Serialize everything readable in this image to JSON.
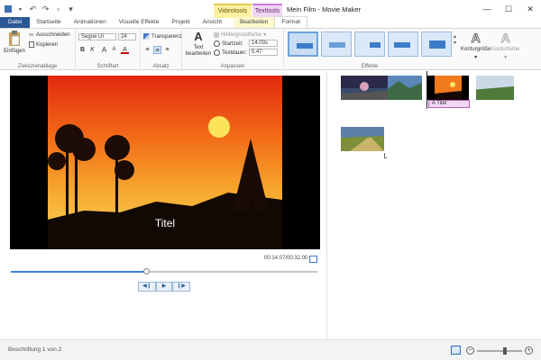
{
  "window": {
    "title": "Mein Film - Movie Maker",
    "context_video": "Videotools",
    "context_text": "Texttools",
    "minimize": "—",
    "maximize": "☐",
    "close": "✕"
  },
  "qat": {
    "save": "▪",
    "undo": "↶",
    "redo": "↷",
    "new": "▫",
    "more": "▾"
  },
  "tabs": [
    {
      "label": "Datei"
    },
    {
      "label": "Startseite"
    },
    {
      "label": "Animationen"
    },
    {
      "label": "Visuelle Effekte"
    },
    {
      "label": "Projekt"
    },
    {
      "label": "Ansicht"
    },
    {
      "label": "Bearbeiten"
    },
    {
      "label": "Format"
    }
  ],
  "ribbon": {
    "clipboard": {
      "label": "Zwischenablage",
      "paste": "Einfügen",
      "cut": "Ausschneiden",
      "copy": "Kopieren"
    },
    "font": {
      "label": "Schriftart",
      "family": "Segoe UI",
      "size": "24",
      "bold": "B",
      "italic": "K",
      "grow": "A",
      "shrink": "A",
      "color": "A"
    },
    "paragraph": {
      "label": "Absatz",
      "transparency": "Transparenz"
    },
    "adjust": {
      "label": "Anpassen",
      "edit_text": "Text bearbeiten",
      "bgcolor": "Hintergrundfarbe",
      "start_label": "Startzeit:",
      "start_value": "14.03s",
      "duration_label": "Textdauer:",
      "duration_value": "5.47"
    },
    "effects": {
      "label": "Effekte",
      "outline_size": "Konturgröße",
      "outline_color": "Konturfarbe"
    }
  },
  "preview": {
    "caption": "Titel",
    "time": "00:14.07/00:32.00",
    "progress": 0.44,
    "prev_frame": "◀❙",
    "play": "▶",
    "next_frame": "❙▶"
  },
  "storyboard": {
    "title_overlay": "Titel",
    "title_icon": "A"
  },
  "status": {
    "text": "Beschriftung 1 von 2",
    "zoom_level": 0.62,
    "zoom_out": "−",
    "zoom_in": "+"
  },
  "colors": {
    "file_tab": "#2b5797",
    "video_tools": "#fdf1a4",
    "text_tools": "#f0d6f2",
    "accent": "#3b82d6"
  }
}
